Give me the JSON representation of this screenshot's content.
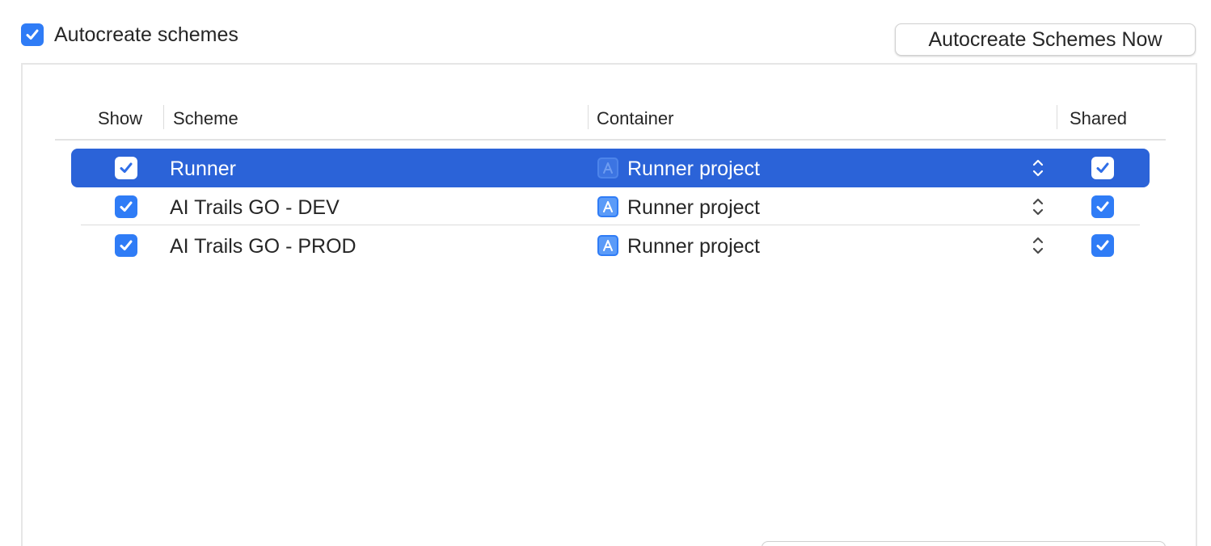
{
  "autocreate": {
    "label": "Autocreate schemes",
    "checked": true
  },
  "autocreate_now_button": "Autocreate Schemes Now",
  "table": {
    "columns": {
      "show": "Show",
      "scheme": "Scheme",
      "container": "Container",
      "shared": "Shared"
    },
    "rows": [
      {
        "show": true,
        "scheme": "Runner",
        "container": "Runner project",
        "shared": true,
        "selected": true
      },
      {
        "show": true,
        "scheme": "AI Trails GO - DEV",
        "container": "Runner project",
        "shared": true,
        "selected": false
      },
      {
        "show": true,
        "scheme": "AI Trails GO - PROD",
        "container": "Runner project",
        "shared": true,
        "selected": false
      }
    ]
  },
  "colors": {
    "accent": "#2f7cf6",
    "selection": "#2b63d8"
  },
  "icons": {
    "checkbox": "checkmark-icon",
    "container": "xcode-project-icon",
    "stepper": "up-down-chevron-icon"
  }
}
